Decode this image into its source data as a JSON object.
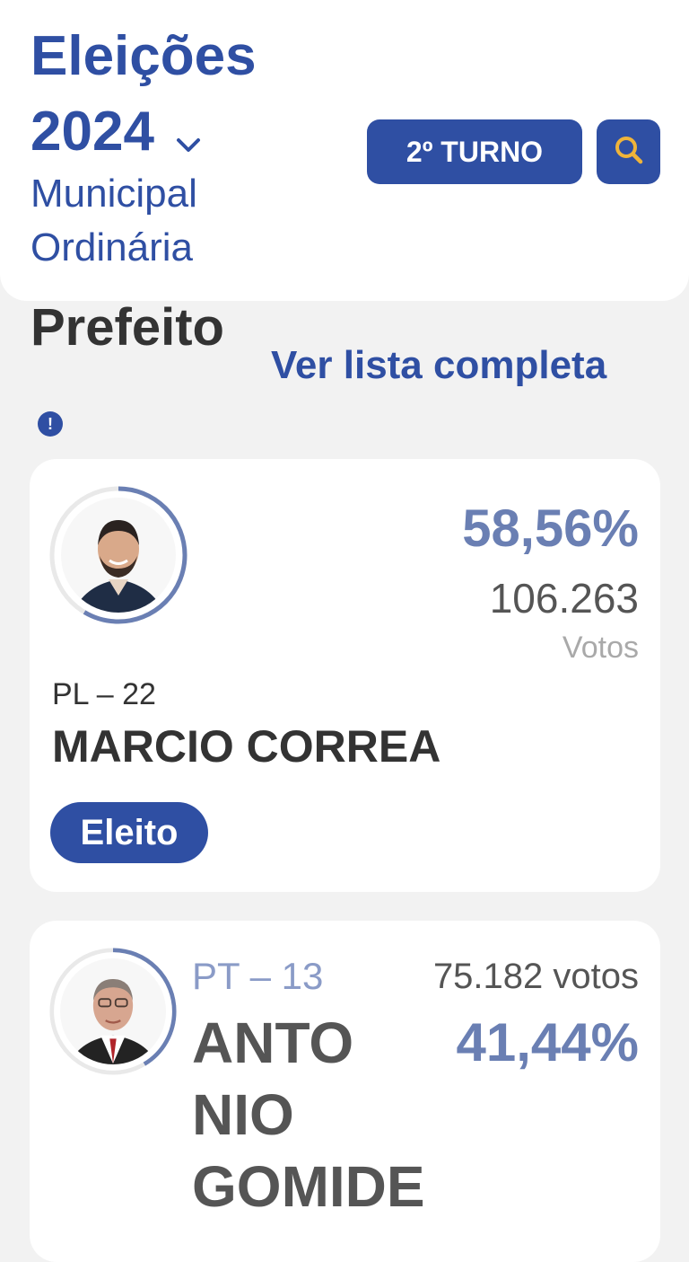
{
  "header": {
    "title_line1": "Eleições",
    "title_line2": "2024",
    "subtitle_line1": "Municipal",
    "subtitle_line2": "Ordinária",
    "turno_button": "2º TURNO"
  },
  "section": {
    "title": "Prefeito",
    "see_all_link": "Ver lista completa",
    "info_icon_glyph": "!"
  },
  "candidates": [
    {
      "percentage": "58,56%",
      "votes": "106.263",
      "votes_label": "Votos",
      "party": "PL – 22",
      "name": "MARCIO CORREA",
      "status": "Eleito",
      "vote_share": 0.5856
    },
    {
      "percentage": "41,44%",
      "votes": "75.182 votos",
      "party": "PT – 13",
      "name_lines": [
        "ANTO",
        "NIO",
        "GOMIDE"
      ],
      "vote_share": 0.4144
    }
  ],
  "colors": {
    "brand": "#2f4fa3",
    "percentage": "#6a7fb3",
    "background": "#f2f2f2",
    "search_icon": "#f0b43a"
  },
  "icons": [
    "chevron-down-icon",
    "search-icon",
    "info-icon"
  ]
}
